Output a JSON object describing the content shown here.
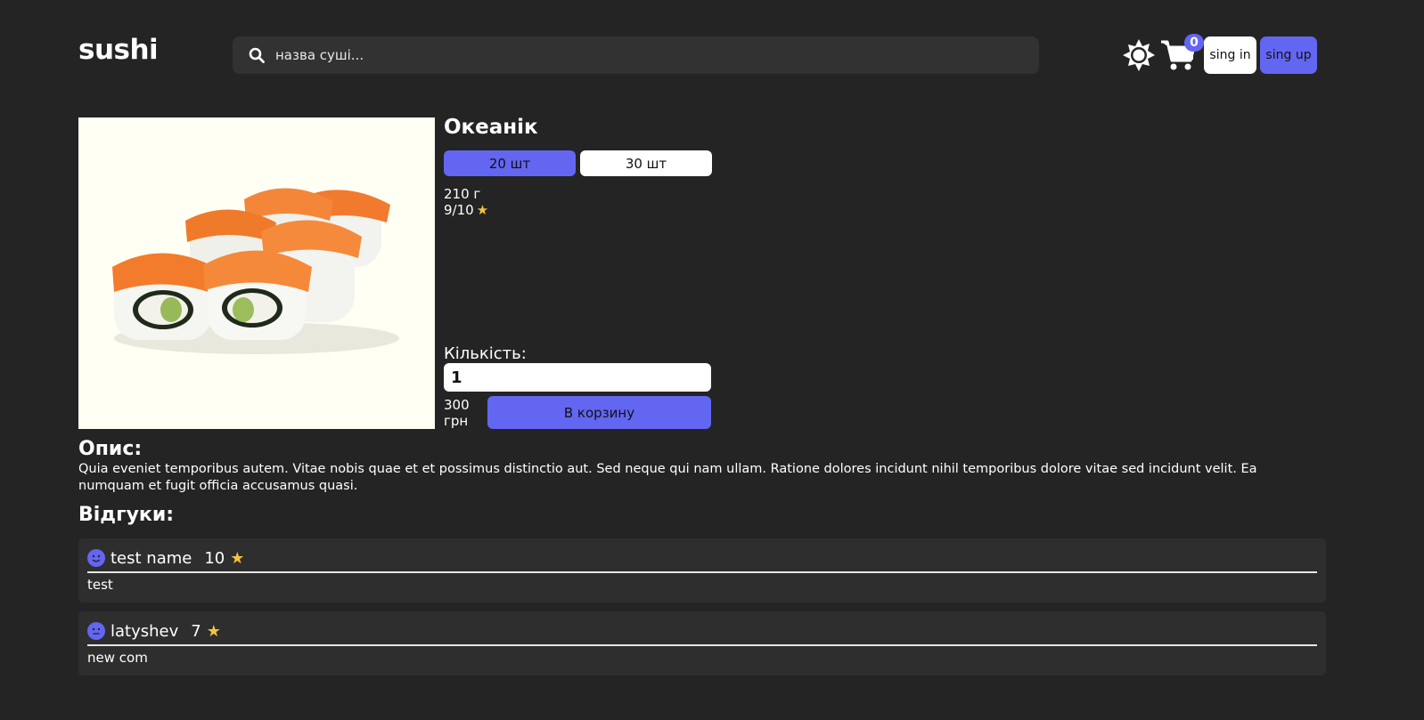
{
  "header": {
    "logo": "sushi",
    "search": {
      "placeholder": "назва суші..."
    },
    "cart_count": "0",
    "signin_label": "sing in",
    "signup_label": "sing up",
    "accent_color": "#6366f1"
  },
  "product": {
    "title": "Океанік",
    "sizes": [
      "20 шт",
      "30 шт"
    ],
    "selected_size": "20 шт",
    "weight": "210 г",
    "rating": "9/10",
    "quantity_label": "Кількість:",
    "quantity_value": "1",
    "price_amount": "300",
    "price_currency": "грн",
    "add_to_cart": "В корзину"
  },
  "description": {
    "title": "Опис:",
    "text": "Quia eveniet temporibus autem. Vitae nobis quae et et possimus distinctio aut. Sed neque qui nam ullam. Ratione dolores incidunt nihil temporibus dolore vitae sed incidunt velit. Ea numquam et fugit officia accusamus quasi."
  },
  "reviews": {
    "title": "Відгуки:",
    "items": [
      {
        "name": "test name",
        "score": "10",
        "text": "test",
        "avatar_icon": "smiling-face-icon"
      },
      {
        "name": "latyshev",
        "score": "7",
        "text": "new com",
        "avatar_icon": "neutral-face-icon"
      }
    ]
  }
}
